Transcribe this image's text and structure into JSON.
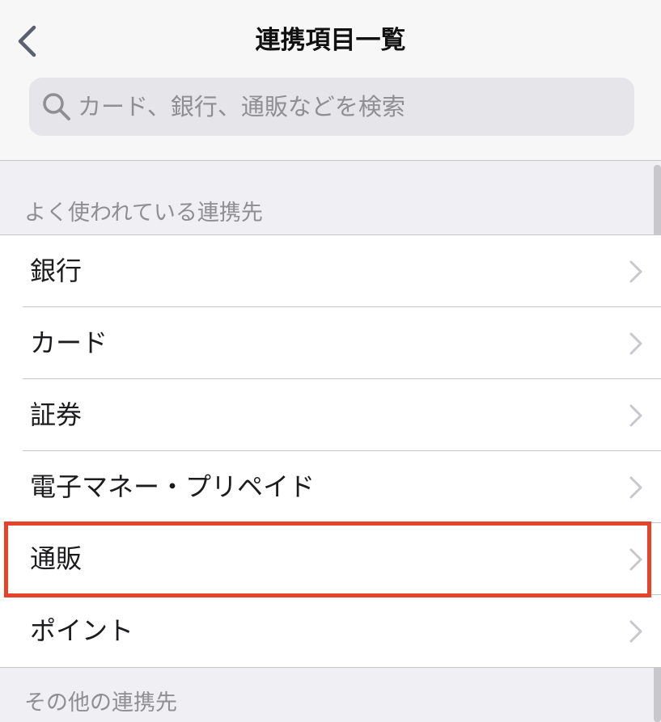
{
  "nav": {
    "back_icon": "chevron-left-icon",
    "title": "連携項目一覧"
  },
  "search": {
    "icon": "magnifier-icon",
    "placeholder": "カード、銀行、通販などを検索",
    "value": ""
  },
  "sections": [
    {
      "header": "よく使われている連携先",
      "items": [
        {
          "label": "銀行"
        },
        {
          "label": "カード"
        },
        {
          "label": "証券"
        },
        {
          "label": "電子マネー・プリペイド"
        },
        {
          "label": "通販"
        },
        {
          "label": "ポイント"
        }
      ]
    },
    {
      "header": "その他の連携先"
    }
  ],
  "highlighted_item": "通販",
  "colors": {
    "highlight_border": "#e8432a",
    "chevron": "#c7c7cc",
    "back_chevron": "#5c5f70",
    "section_header": "#8e8e93",
    "background": "#efeff4"
  }
}
